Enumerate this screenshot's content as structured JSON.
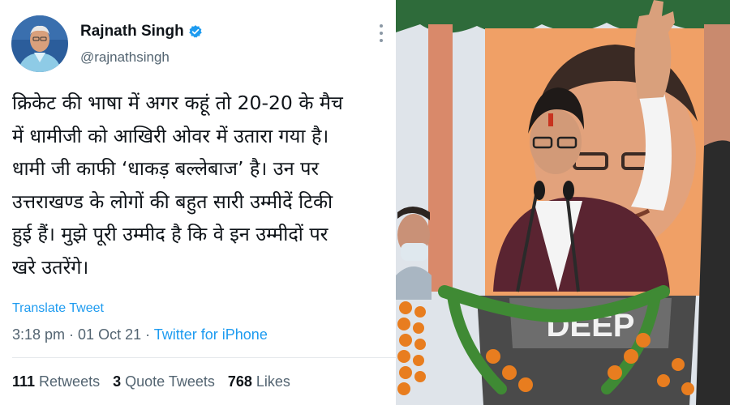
{
  "tweet": {
    "author_name": "Rajnath Singh",
    "handle": "@rajnathsingh",
    "verified_icon": "verified-badge-icon",
    "more_icon": "more-options-icon",
    "body_lines": [
      "क्रिकेट की भाषा में अगर कहूं तो 20-20 के मैच",
      "में धामीजी को आखिरी ओवर में उतारा गया है।",
      "धामी जी काफी ‘धाकड़ बल्लेबाज’ है। उन पर",
      "उत्तराखण्ड के लोगों की बहुत सारी उम्मीदें टिकी",
      "हुई हैं। मुझे पूरी उम्मीद है कि वे इन उम्मीदों पर",
      "खरे उतरेंगे।"
    ],
    "translate_label": "Translate Tweet",
    "time": "3:18 pm",
    "separator": " · ",
    "date": "01 Oct 21",
    "source": "Twitter for iPhone",
    "stats": [
      {
        "count": "111",
        "label": "Retweets"
      },
      {
        "count": "3",
        "label": "Quote Tweets"
      },
      {
        "count": "768",
        "label": "Likes"
      }
    ],
    "accent_color": "#1d9bf0"
  },
  "photo": {
    "podium_text": "DEEP"
  }
}
